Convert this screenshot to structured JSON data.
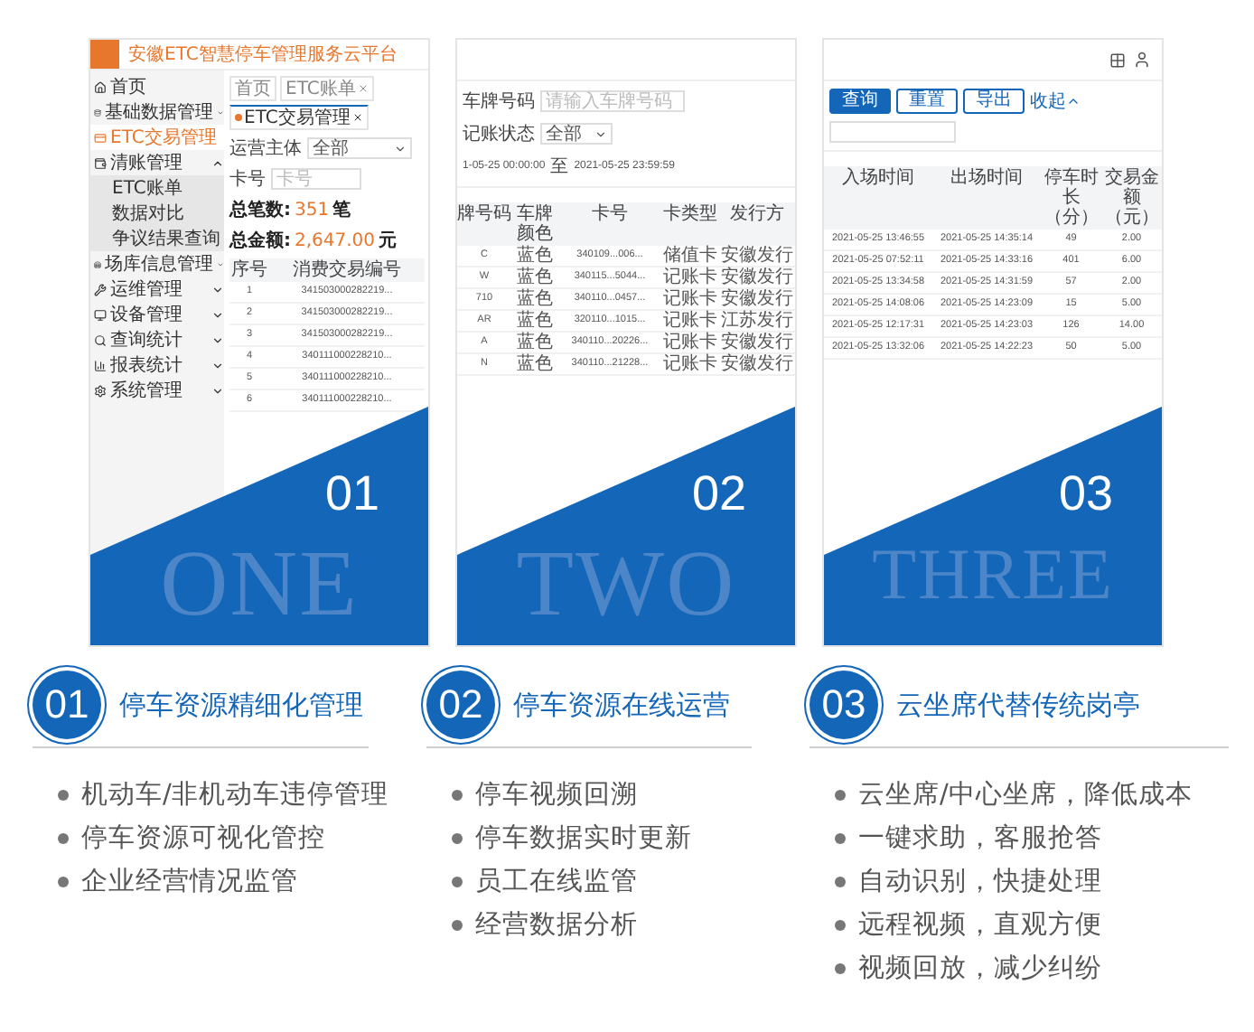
{
  "panels": [
    {
      "number": "01",
      "word": "ONE",
      "screen": {
        "kind": "admin",
        "app_title": "安徽ETC智慧停车管理服务云平台",
        "nav": [
          {
            "label": "首页",
            "selected": false
          },
          {
            "label": "基础数据管理",
            "selected": false,
            "expanded": false
          },
          {
            "label": "ETC交易管理",
            "selected": true
          },
          {
            "label": "清账管理",
            "selected": false,
            "expanded": true,
            "children": [
              {
                "label": "ETC账单",
                "selected": false
              },
              {
                "label": "数据对比",
                "selected": false
              },
              {
                "label": "争议结果查询",
                "selected": false
              }
            ]
          },
          {
            "label": "场库信息管理",
            "selected": false,
            "expanded": false
          },
          {
            "label": "运维管理",
            "selected": false,
            "expanded": false
          },
          {
            "label": "设备管理",
            "selected": false,
            "expanded": false
          },
          {
            "label": "查询统计",
            "selected": false,
            "expanded": false
          },
          {
            "label": "报表统计",
            "selected": false,
            "expanded": false
          },
          {
            "label": "系统管理",
            "selected": false,
            "expanded": false
          }
        ],
        "tabs": [
          {
            "label": "首页",
            "selected": false
          },
          {
            "label": "ETC账单",
            "selected": false
          },
          {
            "label": "ETC交易管理",
            "selected": true
          }
        ],
        "filters": [
          {
            "kind": "select",
            "label": "运营主体",
            "value": "全部"
          },
          {
            "kind": "input",
            "label": "卡号",
            "placeholder": "卡号"
          }
        ],
        "summary": [
          {
            "label": "总笔数:",
            "value": "351",
            "unit": "笔"
          },
          {
            "label": "总金额:",
            "value": "2,647.00",
            "unit": "元"
          }
        ],
        "table": {
          "columns": [
            "序号",
            "消费交易编号"
          ],
          "rows": [
            [
              "1",
              "341503000282219..."
            ],
            [
              "2",
              "341503000282219..."
            ],
            [
              "3",
              "341503000282219..."
            ],
            [
              "4",
              "340111000228210..."
            ],
            [
              "5",
              "340111000228210..."
            ],
            [
              "6",
              "340111000228210..."
            ]
          ]
        }
      }
    },
    {
      "number": "02",
      "word": "TWO",
      "screen": {
        "kind": "query",
        "filters": [
          {
            "kind": "input",
            "label": "车牌号码",
            "placeholder": "请输入车牌号码"
          },
          {
            "kind": "select",
            "label": "记账状态",
            "value": "全部"
          }
        ],
        "date_range": {
          "start": "1-05-25 00:00:00",
          "separator": "至",
          "end": "2021-05-25 23:59:59"
        },
        "table": {
          "columns": [
            "牌号码",
            "车牌颜色",
            "卡号",
            "卡类型",
            "发行方"
          ],
          "rows": [
            [
              "C",
              "蓝色",
              "340109...006...",
              "储值卡",
              "安徽发行"
            ],
            [
              "W",
              "蓝色",
              "340115...5044...",
              "记账卡",
              "安徽发行"
            ],
            [
              "710",
              "蓝色",
              "340110...0457...",
              "记账卡",
              "安徽发行"
            ],
            [
              "AR",
              "蓝色",
              "320110...1015...",
              "记账卡",
              "江苏发行"
            ],
            [
              "A",
              "蓝色",
              "340110...20226...",
              "记账卡",
              "安徽发行"
            ],
            [
              "N",
              "蓝色",
              "340110...21228...",
              "记账卡",
              "安徽发行"
            ]
          ]
        }
      }
    },
    {
      "number": "03",
      "word": "THREE",
      "screen": {
        "kind": "results",
        "buttons": [
          {
            "label": "查询",
            "primary": true
          },
          {
            "label": "重置",
            "primary": false
          },
          {
            "label": "导出",
            "primary": false
          }
        ],
        "collapse": "收起",
        "table": {
          "columns": [
            "入场时间",
            "出场时间",
            "停车时长（分）",
            "交易金额（元）"
          ],
          "rows": [
            [
              "2021-05-25 13:46:55",
              "2021-05-25 14:35:14",
              "49",
              "2.00"
            ],
            [
              "2021-05-25 07:52:11",
              "2021-05-25 14:33:16",
              "401",
              "6.00"
            ],
            [
              "2021-05-25 13:34:58",
              "2021-05-25 14:31:59",
              "57",
              "2.00"
            ],
            [
              "2021-05-25 14:08:06",
              "2021-05-25 14:23:09",
              "15",
              "5.00"
            ],
            [
              "2021-05-25 12:17:31",
              "2021-05-25 14:23:03",
              "126",
              "14.00"
            ],
            [
              "2021-05-25 13:32:06",
              "2021-05-25 14:22:23",
              "50",
              "5.00"
            ]
          ]
        }
      }
    }
  ],
  "features": [
    {
      "number": "01",
      "title": "停车资源精细化管理",
      "bullets": [
        "机动车/非机动车违停管理",
        "停车资源可视化管控",
        "企业经营情况监管"
      ]
    },
    {
      "number": "02",
      "title": "停车资源在线运营",
      "bullets": [
        "停车视频回溯",
        "停车数据实时更新",
        "员工在线监管",
        "经营数据分析"
      ]
    },
    {
      "number": "03",
      "title": "云坐席代替传统岗亭",
      "bullets": [
        "云坐席/中心坐席，降低成本",
        "一键求助，客服抢答",
        "自动识别，快捷处理",
        "远程视频，直观方便",
        "视频回放，减少纠纷"
      ]
    }
  ]
}
